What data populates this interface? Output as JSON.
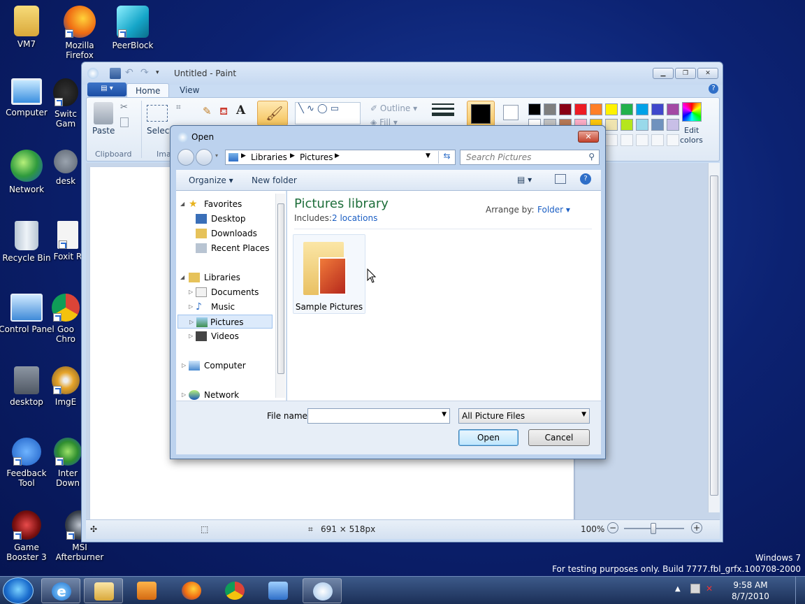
{
  "desktop": {
    "icons": [
      {
        "label": "VM7"
      },
      {
        "label": "Mozilla Firefox"
      },
      {
        "label": "PeerBlock"
      },
      {
        "label": "Computer"
      },
      {
        "label": "Switc Gam"
      },
      {
        "label": "Network"
      },
      {
        "label": "desk"
      },
      {
        "label": "Recycle Bin"
      },
      {
        "label": "Foxit R"
      },
      {
        "label": "Control Panel"
      },
      {
        "label": "Goo Chro"
      },
      {
        "label": "desktop"
      },
      {
        "label": "ImgE"
      },
      {
        "label": "Feedback Tool"
      },
      {
        "label": "Inter Down"
      },
      {
        "label": "Game Booster 3"
      },
      {
        "label": "MSI Afterburner"
      }
    ],
    "watermark_line1": "Windows 7",
    "watermark_line2": "For testing purposes only. Build 7777.fbl_grfx.100708-2000"
  },
  "paint": {
    "title": "Untitled - Paint",
    "tabs": [
      "Home",
      "View"
    ],
    "groups": {
      "clipboard": "Clipboard",
      "image": "Ima",
      "paste": "Paste",
      "select": "Select",
      "outline": "Outline",
      "fill": "Fill",
      "edit_colors_1": "Edit",
      "edit_colors_2": "colors"
    },
    "palette_row1": [
      "#000000",
      "#7f7f7f",
      "#880015",
      "#ed1c24",
      "#ff7f27",
      "#fff200",
      "#22b14c",
      "#00a2e8",
      "#3f48cc",
      "#a349a4"
    ],
    "palette_row2": [
      "#ffffff",
      "#c3c3c3",
      "#b97a57",
      "#ffaec9",
      "#ffc90e",
      "#efe4b0",
      "#b5e61d",
      "#99d9ea",
      "#7092be",
      "#c8bfe7"
    ],
    "status": {
      "dimensions": "691 × 518px",
      "zoom": "100%"
    }
  },
  "dialog": {
    "title": "Open",
    "breadcrumb": [
      "Libraries",
      "Pictures"
    ],
    "search_placeholder": "Search Pictures",
    "toolbar": {
      "organize": "Organize",
      "new_folder": "New folder"
    },
    "nav": {
      "favorites": "Favorites",
      "desktop": "Desktop",
      "downloads": "Downloads",
      "recent": "Recent Places",
      "libraries": "Libraries",
      "documents": "Documents",
      "music": "Music",
      "pictures": "Pictures",
      "videos": "Videos",
      "computer": "Computer",
      "network": "Network"
    },
    "library_title": "Pictures library",
    "includes_label": "Includes:",
    "includes_link": "2 locations",
    "arrange_label": "Arrange by:",
    "arrange_value": "Folder",
    "folder_item": "Sample Pictures",
    "filename_label": "File name:",
    "filename_value": "",
    "filetype": "All Picture Files",
    "open_btn": "Open",
    "cancel_btn": "Cancel"
  },
  "taskbar": {
    "time": "9:58 AM",
    "date": "8/7/2010"
  }
}
